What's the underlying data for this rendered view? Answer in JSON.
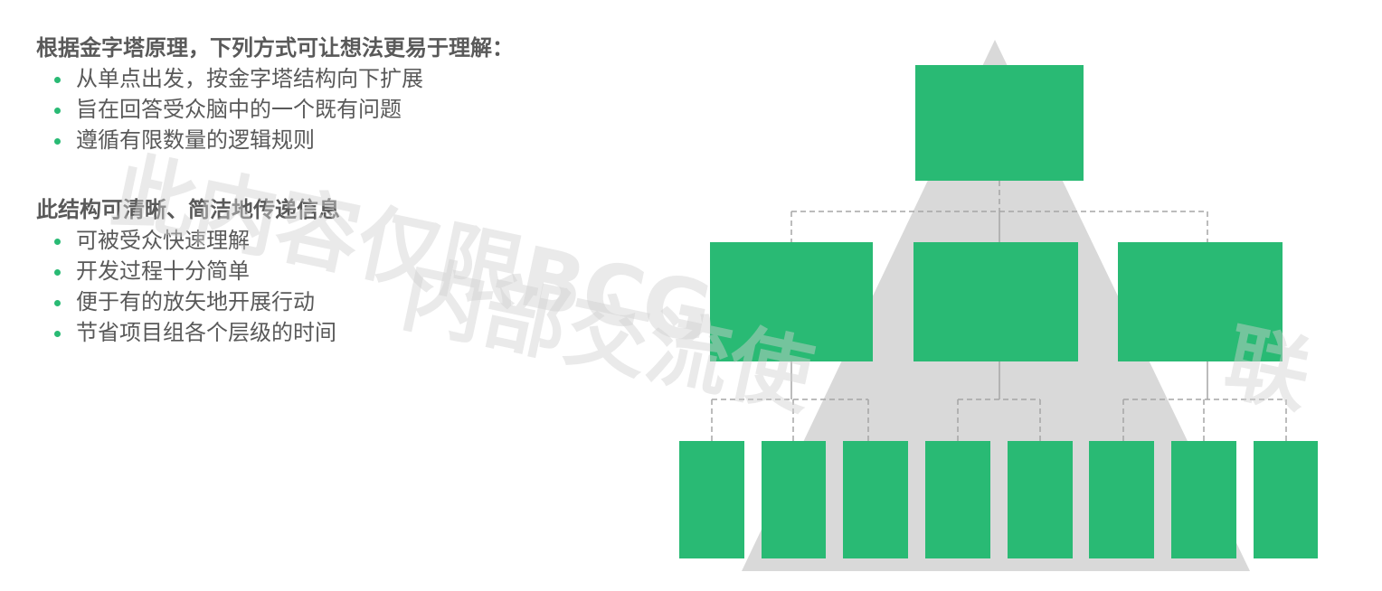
{
  "section_1": {
    "heading": "根据金字塔原理，下列方式可让想法更易于理解：",
    "bullets": [
      "从单点出发，按金字塔结构向下扩展",
      "旨在回答受众脑中的一个既有问题",
      "遵循有限数量的逻辑规则"
    ]
  },
  "section_2": {
    "heading": "此结构可清晰、简洁地传递信息",
    "bullets": [
      "可被受众快速理解",
      "开发过程十分简单",
      "便于有的放矢地开展行动",
      "节省项目组各个层级的时间"
    ]
  },
  "watermark": {
    "line_1": "此内容仅限BCG",
    "line_2": "内部交流使",
    "line_3": "联"
  },
  "colors": {
    "box_fill": "#29ba74",
    "pyramid_fill": "#d9d9d9",
    "bullet": "#29ba74",
    "text": "#595959",
    "connector": "#a6a6a6"
  },
  "pyramid_structure": {
    "level_1_count": 1,
    "level_2_count": 3,
    "level_3_count": 8
  }
}
